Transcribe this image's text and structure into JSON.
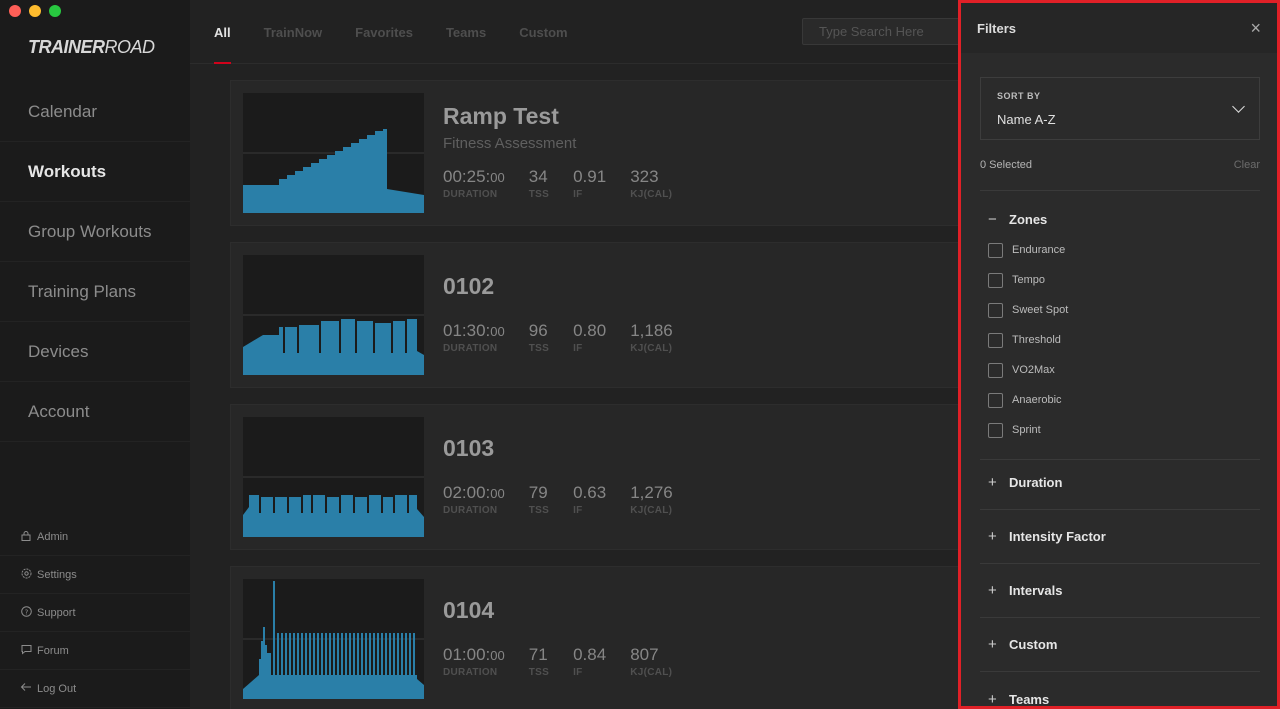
{
  "logo": {
    "bold": "TRAINER",
    "light": "ROAD"
  },
  "sidebar": {
    "nav": [
      {
        "label": "Calendar"
      },
      {
        "label": "Workouts"
      },
      {
        "label": "Group Workouts"
      },
      {
        "label": "Training Plans"
      },
      {
        "label": "Devices"
      },
      {
        "label": "Account"
      }
    ],
    "utility": [
      {
        "label": "Admin",
        "icon": "lock-icon"
      },
      {
        "label": "Settings",
        "icon": "gear-icon"
      },
      {
        "label": "Support",
        "icon": "help-icon"
      },
      {
        "label": "Forum",
        "icon": "chat-icon"
      },
      {
        "label": "Log Out",
        "icon": "logout-arrow-icon"
      }
    ]
  },
  "tabs": [
    {
      "label": "All"
    },
    {
      "label": "TrainNow"
    },
    {
      "label": "Favorites"
    },
    {
      "label": "Teams"
    },
    {
      "label": "Custom"
    }
  ],
  "search": {
    "placeholder": "Type Search Here"
  },
  "workouts": [
    {
      "title": "Ramp Test",
      "subtitle": "Fitness Assessment",
      "duration_main": "00:25:",
      "duration_sec": "00",
      "tss": "34",
      "if": "0.91",
      "kj": "323"
    },
    {
      "title": "0102",
      "subtitle": "",
      "duration_main": "01:30:",
      "duration_sec": "00",
      "tss": "96",
      "if": "0.80",
      "kj": "1,186"
    },
    {
      "title": "0103",
      "subtitle": "",
      "duration_main": "02:00:",
      "duration_sec": "00",
      "tss": "79",
      "if": "0.63",
      "kj": "1,276"
    },
    {
      "title": "0104",
      "subtitle": "",
      "duration_main": "01:00:",
      "duration_sec": "00",
      "tss": "71",
      "if": "0.84",
      "kj": "807"
    }
  ],
  "stat_labels": {
    "duration": "DURATION",
    "tss": "TSS",
    "if": "IF",
    "kj": "KJ(CAL)"
  },
  "filters": {
    "title": "Filters",
    "sort_label": "SORT BY",
    "sort_value": "Name A-Z",
    "selected_count": "0 Selected",
    "clear_label": "Clear",
    "zones": {
      "title": "Zones",
      "toggle": "−",
      "options": [
        "Endurance",
        "Tempo",
        "Sweet Spot",
        "Threshold",
        "VO2Max",
        "Anaerobic",
        "Sprint"
      ]
    },
    "sections": [
      {
        "title": "Duration",
        "toggle": "+"
      },
      {
        "title": "Intensity Factor",
        "toggle": "+"
      },
      {
        "title": "Intervals",
        "toggle": "+"
      },
      {
        "title": "Custom",
        "toggle": "+"
      },
      {
        "title": "Teams",
        "toggle": "+"
      }
    ]
  },
  "colors": {
    "accent": "#d0021b",
    "highlight_border": "#e02027",
    "graph_fill": "#2a7fa8",
    "bg": "#1c1c1c"
  }
}
